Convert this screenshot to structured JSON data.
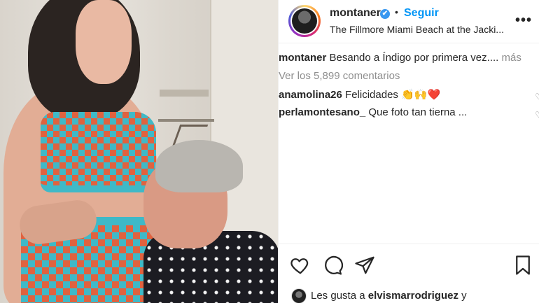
{
  "post": {
    "username": "montaner",
    "verified_badge": "✔",
    "separator": "•",
    "follow_label": "Seguir",
    "location": "The Fillmore Miami Beach at the Jacki...",
    "more_icon": "ellipsis-icon",
    "more_label": "•••"
  },
  "caption": {
    "username": "montaner",
    "text": "Besando a Índigo por primera vez....",
    "more_label": "más"
  },
  "view_all_comments": "Ver los 5,899 comentarios",
  "comments": [
    {
      "username": "anamolina26",
      "text": "Felicidades 👏🙌❤️"
    },
    {
      "username": "perlamontesano_",
      "text": "Que foto tan tierna ..."
    }
  ],
  "likes": {
    "prefix": "Les gusta a",
    "username": "elvismarrodriguez",
    "suffix": "y"
  },
  "icons": {
    "like": "heart-icon",
    "comment": "comment-icon",
    "share": "paper-plane-icon",
    "save": "bookmark-icon"
  },
  "colors": {
    "follow_blue": "#0095f6",
    "verified_blue": "#3897f0",
    "muted_text": "#8e8e8e"
  }
}
